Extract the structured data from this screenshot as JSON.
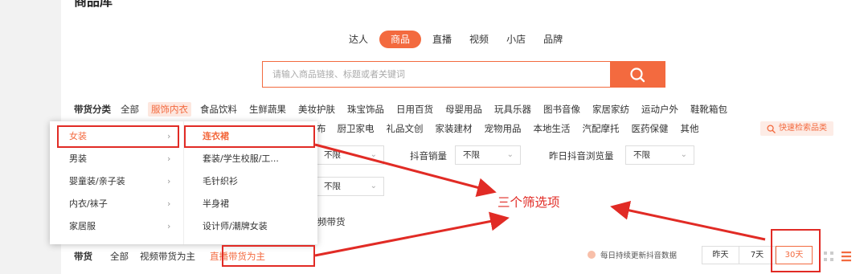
{
  "page": {
    "title": "商品库"
  },
  "tabs": [
    "达人",
    "商品",
    "直播",
    "视频",
    "小店",
    "品牌"
  ],
  "active_tab_index": 1,
  "search": {
    "placeholder": "请输入商品链接、标题或者关键词",
    "button_icon": "search-icon"
  },
  "categories": {
    "label": "带货分类",
    "row1": [
      "全部",
      "服饰内衣",
      "食品饮料",
      "生鲜蔬果",
      "美妆护肤",
      "珠宝饰品",
      "日用百货",
      "母婴用品",
      "玩具乐器",
      "图书音像",
      "家居家纺",
      "运动户外",
      "鞋靴箱包"
    ],
    "row1_active_index": 1,
    "row2_partial": "布",
    "row2": [
      "厨卫家电",
      "礼品文创",
      "家装建材",
      "宠物用品",
      "本地生活",
      "汽配摩托",
      "医药保健",
      "其他"
    ],
    "quick_search": "快速检索品类"
  },
  "filters": {
    "select_default": "不限",
    "douyin_sales_label": "抖音销量",
    "yesterday_views_label": "昨日抖音浏览量",
    "partial_text": "频带货"
  },
  "dropdown": {
    "left": [
      "女装",
      "男装",
      "婴童装/亲子装",
      "内衣/袜子",
      "家居服"
    ],
    "left_active_index": 0,
    "right": [
      "连衣裙",
      "套装/学生校服/工...",
      "毛针织衫",
      "半身裙",
      "设计师/潮牌女装"
    ],
    "right_active_index": 0
  },
  "bottom": {
    "label": "带货",
    "items": [
      "全部",
      "视频带货为主",
      "直播带货为主"
    ],
    "active_index": 2,
    "legend_text": "每日持续更新抖音数据",
    "days": [
      "昨天",
      "7天",
      "30天"
    ],
    "active_day_index": 2
  },
  "annotation": {
    "text": "三个筛选项",
    "color": "#e12b25"
  },
  "colors": {
    "accent": "#f36a3f",
    "highlight": "#e12b25"
  }
}
